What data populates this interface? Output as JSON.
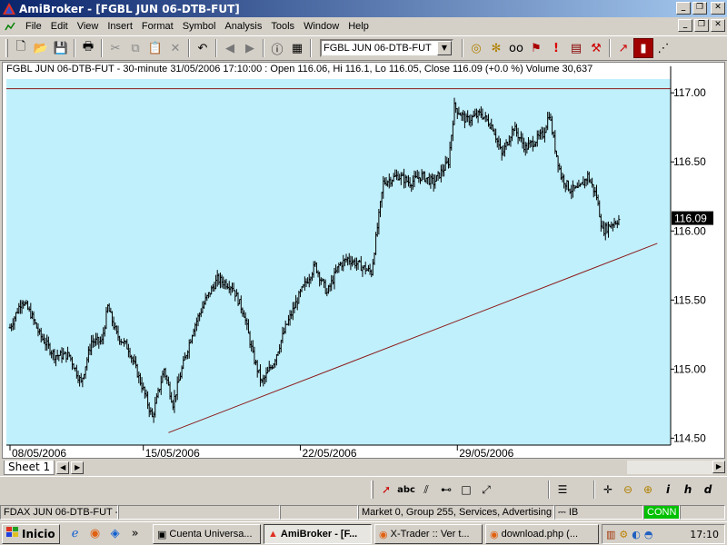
{
  "window": {
    "title": "AmiBroker - [FGBL JUN 06-DTB-FUT]"
  },
  "menu": [
    "File",
    "Edit",
    "View",
    "Insert",
    "Format",
    "Symbol",
    "Analysis",
    "Tools",
    "Window",
    "Help"
  ],
  "toolbar": {
    "symbol_value": "FGBL JUN 06-DTB-FUT"
  },
  "chart": {
    "header": "FGBL JUN 06-DTB-FUT - 30-minute 31/05/2006 17:10:00 : Open 116.06, Hi 116.1, Lo 116.05, Close 116.09 (+0.0 %) Volume 30,637",
    "last_price_label": "116.09",
    "background": "#c0f0fc",
    "bar_color": "#000000",
    "line_color": "#8b1a1a",
    "price_label_bg": "#000000"
  },
  "chart_data": {
    "type": "ohlc",
    "y_ticks": [
      "117.00",
      "116.50",
      "116.00",
      "115.50",
      "115.00",
      "114.50"
    ],
    "ylim": [
      114.45,
      117.1
    ],
    "x_ticks": [
      {
        "label": "08/05/2006",
        "bar": 0
      },
      {
        "label": "15/05/2006",
        "bar": 90
      },
      {
        "label": "22/05/2006",
        "bar": 196
      },
      {
        "label": "29/05/2006",
        "bar": 302
      }
    ],
    "total_bars": 360,
    "anchors": [
      [
        0,
        115.3
      ],
      [
        8,
        115.5
      ],
      [
        14,
        115.4
      ],
      [
        20,
        115.25
      ],
      [
        30,
        115.1
      ],
      [
        40,
        115.1
      ],
      [
        48,
        114.9
      ],
      [
        55,
        115.2
      ],
      [
        62,
        115.2
      ],
      [
        66,
        115.45
      ],
      [
        72,
        115.25
      ],
      [
        80,
        115.15
      ],
      [
        90,
        114.85
      ],
      [
        96,
        114.65
      ],
      [
        104,
        115.0
      ],
      [
        110,
        114.75
      ],
      [
        116,
        115.0
      ],
      [
        124,
        115.3
      ],
      [
        132,
        115.5
      ],
      [
        140,
        115.65
      ],
      [
        150,
        115.6
      ],
      [
        158,
        115.4
      ],
      [
        164,
        115.1
      ],
      [
        170,
        114.9
      ],
      [
        178,
        115.05
      ],
      [
        186,
        115.3
      ],
      [
        196,
        115.55
      ],
      [
        206,
        115.75
      ],
      [
        214,
        115.55
      ],
      [
        222,
        115.75
      ],
      [
        228,
        115.8
      ],
      [
        236,
        115.75
      ],
      [
        244,
        115.7
      ],
      [
        252,
        116.35
      ],
      [
        262,
        116.4
      ],
      [
        270,
        116.35
      ],
      [
        278,
        116.4
      ],
      [
        286,
        116.35
      ],
      [
        296,
        116.5
      ],
      [
        300,
        116.9
      ],
      [
        308,
        116.8
      ],
      [
        318,
        116.85
      ],
      [
        326,
        116.75
      ],
      [
        332,
        116.55
      ],
      [
        340,
        116.75
      ],
      [
        348,
        116.6
      ],
      [
        354,
        116.65
      ],
      [
        360,
        116.7
      ],
      [
        364,
        116.85
      ],
      [
        368,
        116.6
      ],
      [
        372,
        116.4
      ],
      [
        378,
        116.3
      ],
      [
        384,
        116.3
      ],
      [
        390,
        116.4
      ],
      [
        396,
        116.25
      ],
      [
        400,
        116.0
      ],
      [
        406,
        116.05
      ],
      [
        412,
        116.09
      ]
    ],
    "trendline": {
      "from": {
        "bar": 107,
        "price": 114.54
      },
      "to": {
        "bar": 437,
        "price": 115.91
      }
    },
    "top_line_price": 117.03
  },
  "sheet": {
    "tab_label": "Sheet 1"
  },
  "status": {
    "left": "FDAX JUN 06-DTB-FUT - 1",
    "market": "Market 0, Group 255, Services, Advertising",
    "source": "IB",
    "conn": "CONN"
  },
  "taskbar": {
    "start": "Inicio",
    "tasks": [
      "Cuenta Universa...",
      "AmiBroker - [F...",
      "X-Trader :: Ver t...",
      "download.php (..."
    ],
    "clock": "17:10"
  }
}
